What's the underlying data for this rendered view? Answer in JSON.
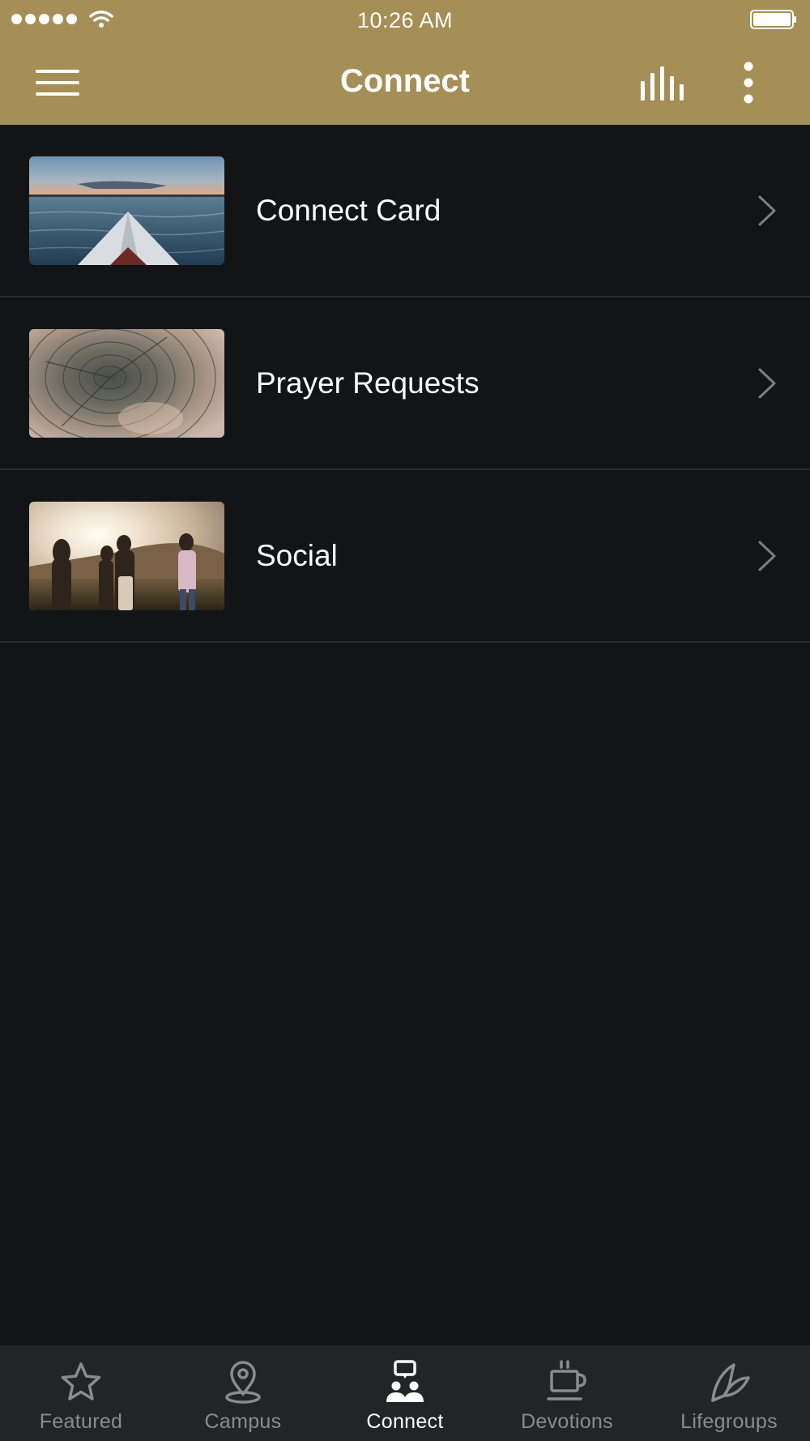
{
  "status_bar": {
    "time": "10:26 AM"
  },
  "header": {
    "title": "Connect",
    "background": "#a58f56",
    "icons": [
      "hamburger-menu-icon",
      "bar-stats-icon",
      "more-vertical-icon"
    ]
  },
  "list": {
    "items": [
      {
        "label": "Connect Card",
        "thumbnail": "lake-kayak-image"
      },
      {
        "label": "Prayer Requests",
        "thumbnail": "tree-rings-image"
      },
      {
        "label": "Social",
        "thumbnail": "friends-sunset-image"
      }
    ]
  },
  "tabs": {
    "active": "Connect",
    "items": [
      {
        "label": "Featured",
        "icon": "star-icon"
      },
      {
        "label": "Campus",
        "icon": "map-pin-icon"
      },
      {
        "label": "Connect",
        "icon": "people-chat-icon"
      },
      {
        "label": "Devotions",
        "icon": "coffee-cup-icon"
      },
      {
        "label": "Lifegroups",
        "icon": "leaf-icon"
      }
    ]
  },
  "colors": {
    "background": "#131416",
    "tab_bar": "#232427",
    "divider": "#2a2b2e",
    "inactive_tab": "#8a8b8e"
  }
}
